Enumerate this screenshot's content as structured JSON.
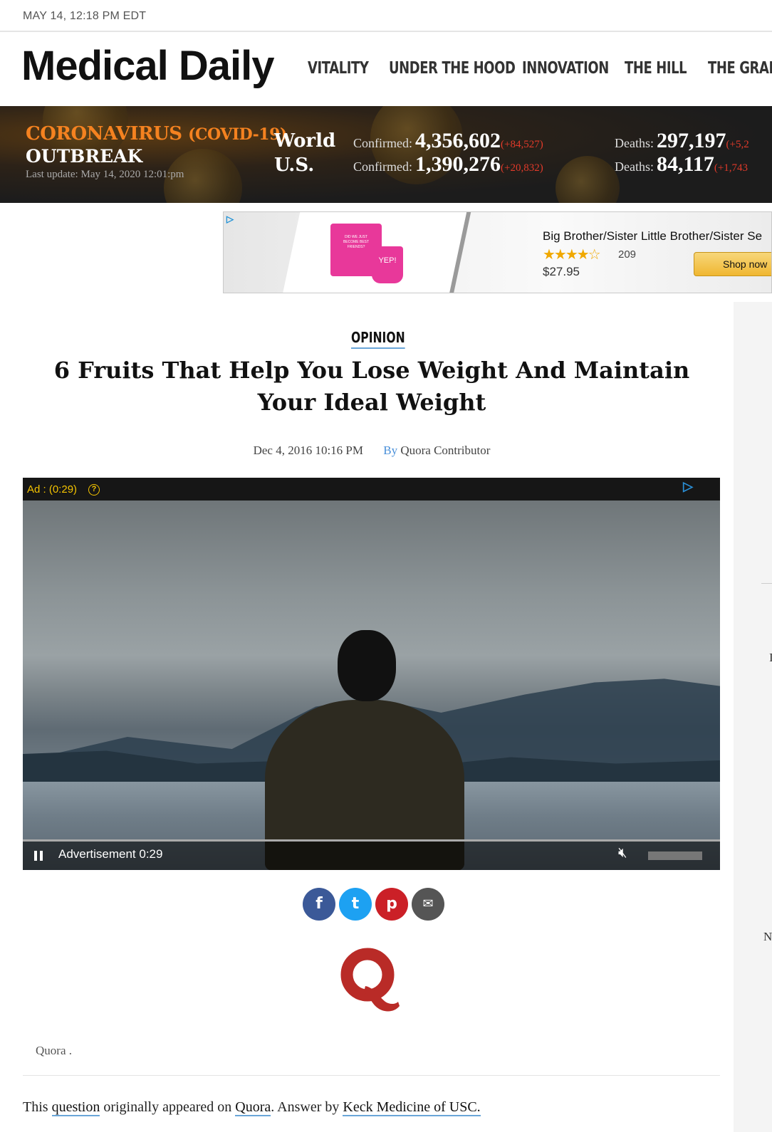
{
  "datebar": {
    "timestamp": "MAY 14, 12:18 PM EDT"
  },
  "header": {
    "logo": "Medical Daily",
    "nav": [
      "VITALITY",
      "UNDER THE HOOD",
      "INNOVATION",
      "THE HILL",
      "THE GRAPE"
    ]
  },
  "covid": {
    "title": "CORONAVIRUS",
    "title_suffix": "(COVID-19)",
    "subtitle": "OUTBREAK",
    "last_update": "Last update: May 14, 2020 12:01:pm",
    "rows": [
      {
        "region": "World",
        "confirmed_label": "Confirmed:",
        "confirmed": "4,356,602",
        "confirmed_delta": "(+84,527)",
        "deaths_label": "Deaths:",
        "deaths": "297,197",
        "deaths_delta": "(+5,2"
      },
      {
        "region": "U.S.",
        "confirmed_label": "Confirmed:",
        "confirmed": "1,390,276",
        "confirmed_delta": "(+20,832)",
        "deaths_label": "Deaths:",
        "deaths": "84,117",
        "deaths_delta": "(+1,743"
      }
    ],
    "colors": {
      "accent": "#f58220",
      "delta": "#e23a2a"
    }
  },
  "ad": {
    "title": "Big Brother/Sister Little Brother/Sister Se",
    "stars": "★★★★☆",
    "rating_count": "209",
    "price": "$27.95",
    "button": "Shop now",
    "shirt_text_1": "DID WE JUST BECOME BEST FRIENDS?",
    "shirt_text_2": "YEP!"
  },
  "article": {
    "category": "OPINION",
    "title": "6 Fruits That Help You Lose Weight And Maintain Your Ideal Weight",
    "date": "Dec 4, 2016 10:16 PM",
    "by_label": "By",
    "author": "Quora Contributor",
    "caption": "Quora .",
    "lede_1": "This ",
    "lede_link_1": "question",
    "lede_2": " originally appeared on ",
    "lede_link_2": "Quora",
    "lede_3": ". Answer by ",
    "lede_link_3": "Keck Medicine of USC."
  },
  "video": {
    "ad_label": "Ad : (0:29)",
    "help": "?",
    "bottom_label": "Advertisement 0:29",
    "mute_icon": "muted-speaker-icon"
  },
  "share": {
    "facebook": "f",
    "twitter": "t",
    "pinterest": "p",
    "email": "✉"
  },
  "side": {
    "c1": "I",
    "c2": "N"
  }
}
